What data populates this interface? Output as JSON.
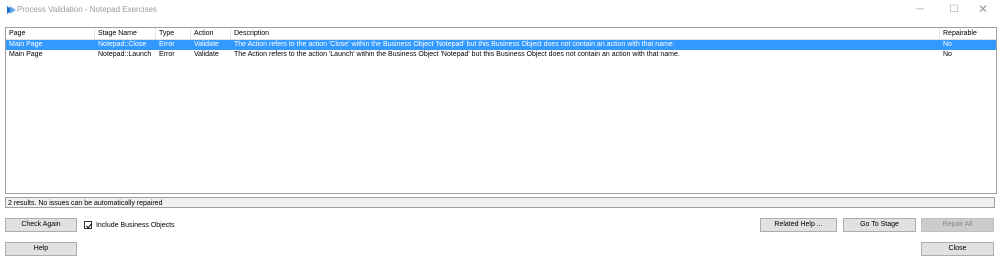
{
  "window": {
    "title": "Process Validation - Notepad Exercises",
    "minimize_glyph": "─",
    "maximize_glyph": "☐",
    "close_glyph": "✕",
    "app_icon": "blue-prism-logo-icon"
  },
  "grid": {
    "columns": [
      "Page",
      "Stage Name",
      "Type",
      "Action",
      "Description",
      "Repairable"
    ],
    "rows": [
      {
        "page": "Main Page",
        "stage_name": "Notepad::Close",
        "type": "Error",
        "action": "Validate",
        "description": "The Action refers to the action 'Close' within the Business Object 'Notepad' but this Business Object does not contain an action with that name.",
        "repairable": "No",
        "selected": true
      },
      {
        "page": "Main Page",
        "stage_name": "Notepad::Launch",
        "type": "Error",
        "action": "Validate",
        "description": "The Action refers to the action 'Launch' within the Business Object 'Notepad' but this Business Object does not contain an action with that name.",
        "repairable": "No",
        "selected": false
      }
    ]
  },
  "status_text": "2 results. No issues can be automatically repaired",
  "buttons": {
    "check_again": "Check Again",
    "include_business_objects": "Include Business Objects",
    "related_help": "Related Help ...",
    "go_to_stage": "Go To Stage",
    "repair_all": "Repair All",
    "help": "Help",
    "close": "Close"
  },
  "include_business_objects_checked": true,
  "colors": {
    "selection": "#3399ff",
    "accent_icon": "#1f6fd0"
  }
}
